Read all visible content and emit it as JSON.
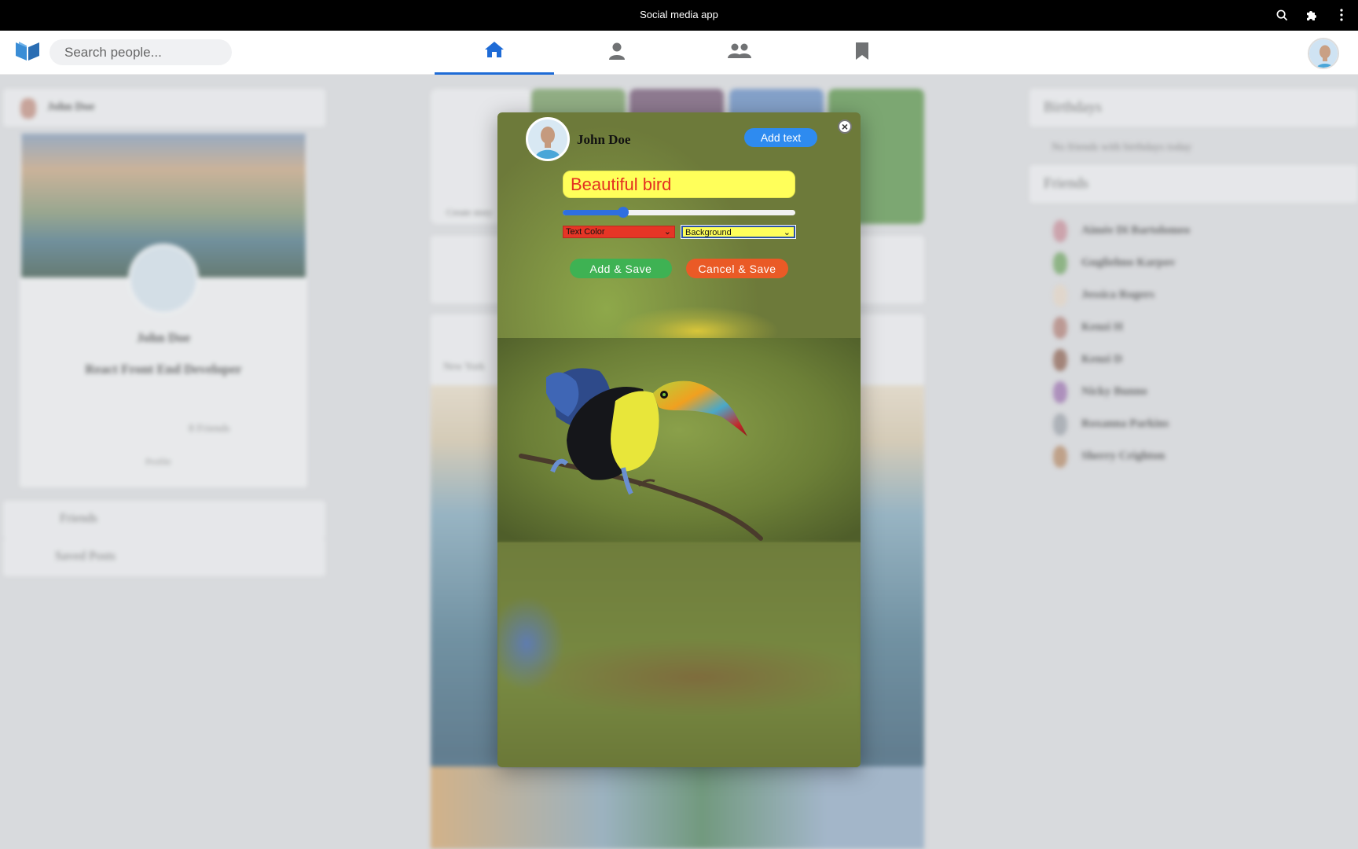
{
  "window": {
    "title": "Social media app"
  },
  "navbar": {
    "search_placeholder": "Search people...",
    "tabs": [
      {
        "name": "home",
        "icon": "home-icon",
        "active": true
      },
      {
        "name": "profile",
        "icon": "user-icon",
        "active": false
      },
      {
        "name": "friends",
        "icon": "users-icon",
        "active": false
      },
      {
        "name": "saved",
        "icon": "bookmark-icon",
        "active": false
      }
    ]
  },
  "background": {
    "profile_card": {
      "name": "John Doe",
      "title": "React Front End Developer",
      "friends_count": "8 Friends",
      "profile_link": "Profile"
    },
    "left_menu": [
      "Friends",
      "Saved Posts"
    ],
    "right": {
      "birthdays_title": "Birthdays",
      "birthdays_text": "No friends with birthdays today",
      "friends_title": "Friends",
      "friends": [
        "Aimée Di Bartolomeo",
        "Guglielmo Karpov",
        "Jessica Rogers",
        "Kenzi H",
        "Kenzi D",
        "Nicky Bunno",
        "Roxanna Parkins",
        "Sherry Crighton"
      ]
    },
    "feed": {
      "create_story": "Create story",
      "new_york": "New York"
    }
  },
  "modal": {
    "user_name": "John Doe",
    "add_text_label": "Add text",
    "close_label": "×",
    "text_value": "Beautiful bird",
    "slider_value": 0.26,
    "text_color_select": "Text Color",
    "background_select": "Background",
    "add_save_label": "Add & Save",
    "cancel_save_label": "Cancel & Save",
    "colors": {
      "text_bg": "#ffff5a",
      "text_color": "#e33020",
      "add_text_btn": "#2e8bf0",
      "add_save_btn": "#3eb253",
      "cancel_save_btn": "#ea5a26",
      "accent": "#1e6bd6"
    }
  }
}
